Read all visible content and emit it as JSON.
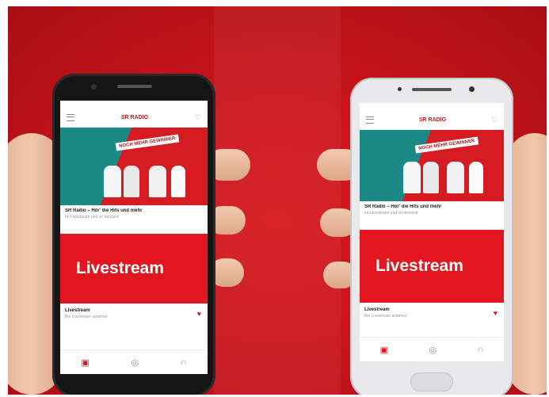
{
  "phones": [
    {
      "app_title": "SR RADIO",
      "banner_tag": "NOCH MEHR GEWINNER",
      "featured_title": "SR Radio – Hör' die Hits und mehr",
      "featured_subtitle": "Im Livestream und on demand",
      "livestream_label": "Livestream",
      "item_title": "Livestream",
      "item_subtitle": "Bei Livestream ansehen"
    },
    {
      "app_title": "SR RADIO",
      "banner_tag": "NOCH MEHR GEWINNER",
      "featured_title": "SR Radio – Hör' die Hits und mehr",
      "featured_subtitle": "Im Livestream und on demand",
      "livestream_label": "Livestream",
      "item_title": "Livestream",
      "item_subtitle": "Bei Livestream ansehen"
    }
  ],
  "colors": {
    "accent": "#e3161f",
    "background": "#c8141b",
    "teal": "#1b8a86"
  },
  "icons": [
    "menu-icon",
    "heart-icon",
    "radio-icon",
    "globe-icon",
    "headphones-icon"
  ]
}
